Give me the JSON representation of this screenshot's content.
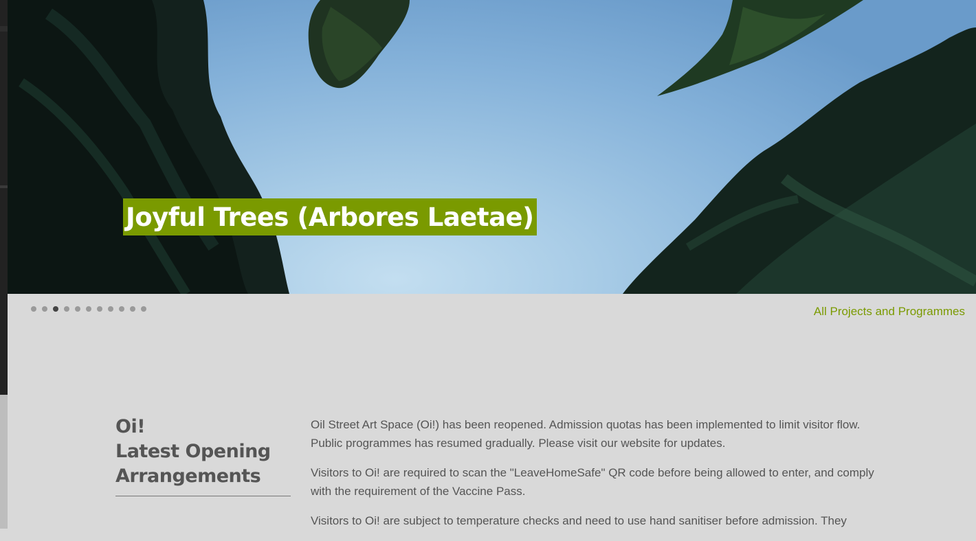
{
  "hero": {
    "title": "Joyful Trees (Arbores Laetae)",
    "title_bg_color": "#7a9a00",
    "image": "trees-looking-up-at-sky"
  },
  "carousel": {
    "total_slides": 11,
    "active_index": 2
  },
  "links": {
    "all_projects": "All Projects and Programmes"
  },
  "section": {
    "title_line1": "Oi!",
    "title_line2": "Latest Opening",
    "title_line3": "Arrangements",
    "paragraphs": [
      "Oil Street Art Space (Oi!) has been reopened. Admission quotas has been implemented to limit visitor flow. Public programmes has resumed gradually. Please visit our website for updates.",
      "Visitors to Oi! are required to scan the \"LeaveHomeSafe\" QR code before being allowed to enter, and comply with the requirement of the Vaccine Pass.",
      "Visitors to Oi! are subject to temperature checks and need to use hand sanitiser before admission. They"
    ]
  },
  "colors": {
    "accent": "#7a9a00",
    "page_bg": "#d9d9d9",
    "text": "#555555"
  }
}
